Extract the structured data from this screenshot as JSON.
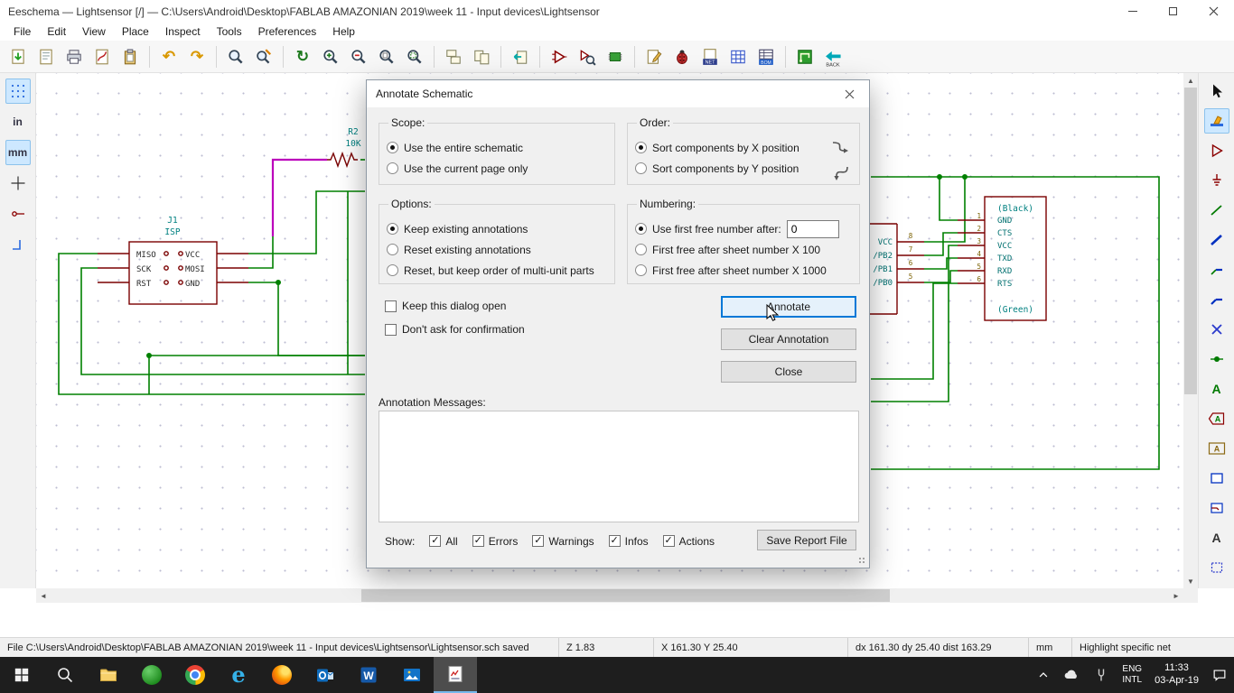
{
  "window": {
    "title": "Eeschema — Lightsensor [/] — C:\\Users\\Android\\Desktop\\FABLAB AMAZONIAN 2019\\week 11 - Input devices\\Lightsensor"
  },
  "menubar": {
    "items": [
      "File",
      "Edit",
      "View",
      "Place",
      "Inspect",
      "Tools",
      "Preferences",
      "Help"
    ]
  },
  "toolbar": {
    "badges": {
      "netlist": "NET",
      "bom": "BOM",
      "back": "BACK"
    }
  },
  "left_toolbar": {
    "inch": "in",
    "mm": "mm"
  },
  "icons": {
    "check": "✓",
    "undo": "↶",
    "redo": "↷",
    "refresh": "↻",
    "letter_a": "A",
    "edge": "e",
    "word": "W"
  },
  "dialog": {
    "title": "Annotate Schematic",
    "scope": {
      "legend": "Scope:",
      "radio1": "Use the entire schematic",
      "radio2": "Use the current page only"
    },
    "order": {
      "legend": "Order:",
      "radio1": "Sort components by X position",
      "radio2": "Sort components by Y position"
    },
    "options": {
      "legend": "Options:",
      "radio1": "Keep existing annotations",
      "radio2": "Reset existing annotations",
      "radio3": "Reset, but keep order of multi-unit parts"
    },
    "numbering": {
      "legend": "Numbering:",
      "radio1": "Use first free number after:",
      "value": "0",
      "radio2": "First free after sheet number X 100",
      "radio3": "First free after sheet number X 1000"
    },
    "keep_open": "Keep this dialog open",
    "dont_ask": "Don't ask for confirmation",
    "annotate_btn": "Annotate",
    "clear_btn": "Clear Annotation",
    "close_btn": "Close",
    "messages_label": "Annotation Messages:",
    "show_label": "Show:",
    "show_all": "All",
    "show_errors": "Errors",
    "show_warnings": "Warnings",
    "show_infos": "Infos",
    "show_actions": "Actions",
    "save_report_btn": "Save Report File"
  },
  "schematic": {
    "j1": {
      "ref": "J1",
      "value": "ISP",
      "left_pins": [
        "MISO",
        "SCK",
        "RST"
      ],
      "right_pins": [
        "VCC",
        "MOSI",
        "GND"
      ]
    },
    "r2": {
      "ref": "R2",
      "value": "10K"
    },
    "conn": {
      "top": "(Black)",
      "pins": [
        "GND",
        "CTS",
        "VCC",
        "TXD",
        "RXD",
        "RTS"
      ],
      "numbers": [
        "1",
        "2",
        "3",
        "4",
        "5",
        "6"
      ],
      "bottom": "(Green)"
    },
    "mcu": {
      "pins": [
        "VCC",
        "/PB2",
        "/PB1",
        "/PB0"
      ],
      "numbers": [
        "8",
        "7",
        "6",
        "5"
      ]
    }
  },
  "statusbar": {
    "file": "File C:\\Users\\Android\\Desktop\\FABLAB AMAZONIAN 2019\\week 11 - Input devices\\Lightsensor\\Lightsensor.sch saved",
    "zoom": "Z 1.83",
    "position": "X 161.30  Y 25.40",
    "delta": "dx 161.30  dy 25.40  dist 163.29",
    "units": "mm",
    "mode": "Highlight specific net"
  },
  "taskbar": {
    "lang1": "ENG",
    "lang2": "INTL",
    "time": "11:33",
    "date": "03-Apr-19"
  }
}
